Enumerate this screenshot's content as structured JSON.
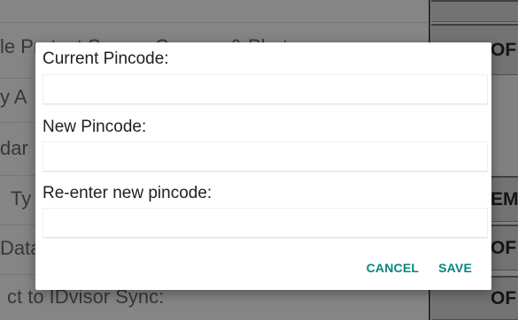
{
  "background": {
    "rows": [
      {
        "label": "le Protect Screen Camera & Photo",
        "action": "OF"
      },
      {
        "label": "y A",
        "action": ""
      },
      {
        "label": "dar",
        "action": ""
      },
      {
        "label": "Ty",
        "action": "EM"
      },
      {
        "label": "Data",
        "action": "OF"
      },
      {
        "label": "ct to IDvisor Sync:",
        "action": "OF"
      }
    ]
  },
  "dialog": {
    "current_pincode_label": "Current Pincode:",
    "current_pincode_value": "",
    "new_pincode_label": "New Pincode:",
    "new_pincode_value": "",
    "reenter_pincode_label": "Re-enter new pincode:",
    "reenter_pincode_value": "",
    "cancel_label": "CANCEL",
    "save_label": "SAVE"
  },
  "colors": {
    "accent": "#00897b",
    "scrim": "rgba(0,0,0,0.48)"
  }
}
